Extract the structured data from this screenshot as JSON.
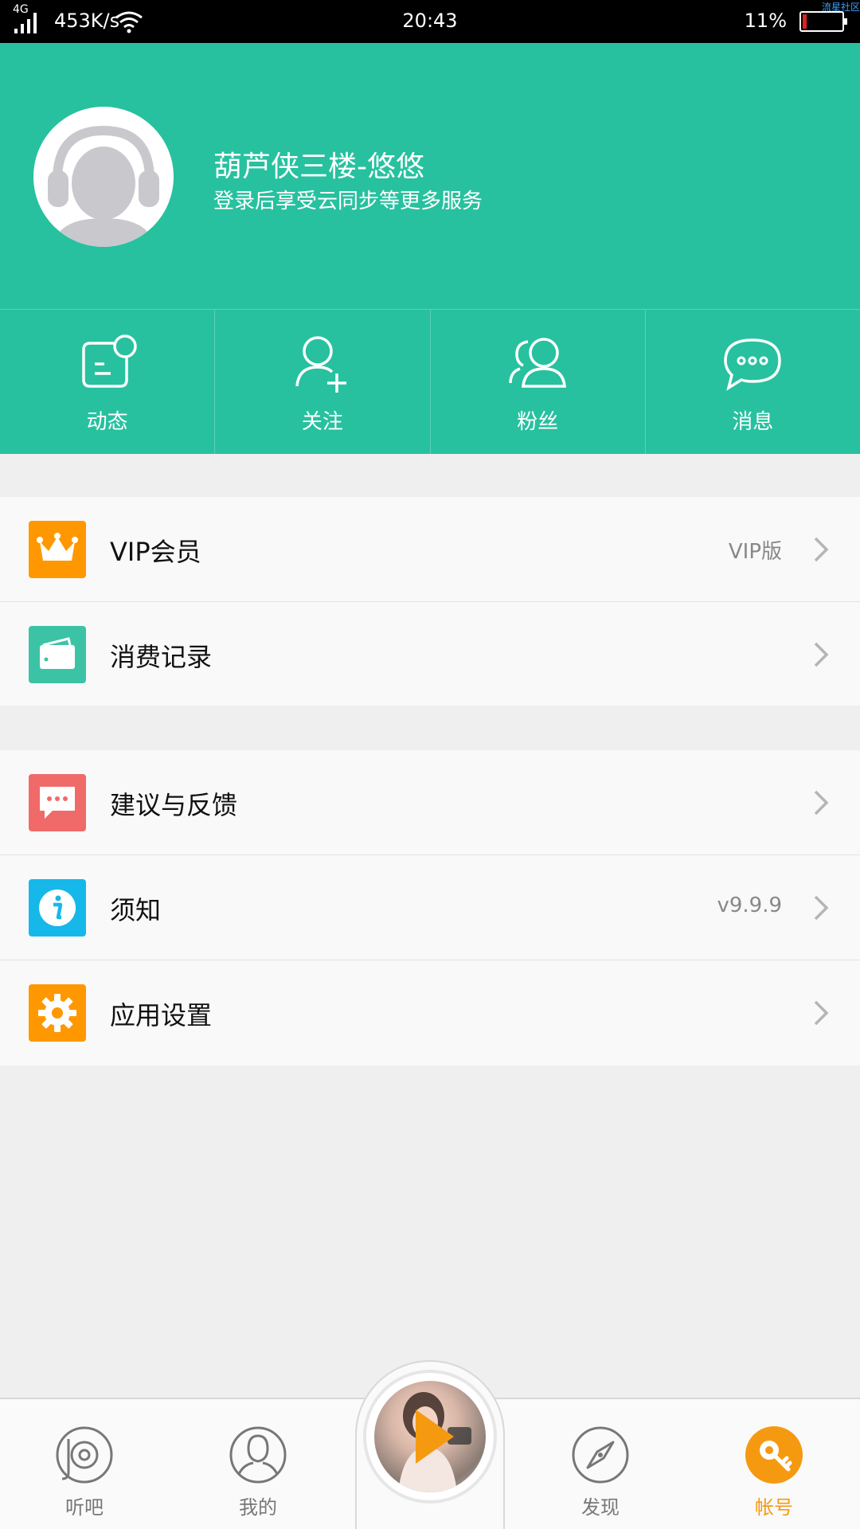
{
  "status_bar": {
    "network": "4G",
    "speed": "453K/s",
    "time": "20:43",
    "battery": "11%",
    "battery_level": 0.11,
    "watermark": "流星社区"
  },
  "profile": {
    "name": "葫芦侠三楼-悠悠",
    "subtitle": "登录后享受云同步等更多服务"
  },
  "stats": [
    {
      "label": "动态",
      "icon": "dynamic-icon"
    },
    {
      "label": "关注",
      "icon": "follow-icon"
    },
    {
      "label": "粉丝",
      "icon": "fans-icon"
    },
    {
      "label": "消息",
      "icon": "message-icon"
    }
  ],
  "menu_group_1": [
    {
      "label": "VIP会员",
      "value": "VIP版",
      "icon": "crown-icon",
      "color": "#ff9800"
    },
    {
      "label": "消费记录",
      "value": "",
      "icon": "wallet-icon",
      "color": "#3cc3a6"
    }
  ],
  "menu_group_2": [
    {
      "label": "建议与反馈",
      "value": "",
      "icon": "feedback-icon",
      "color": "#f06a6a"
    },
    {
      "label": "须知",
      "value": "v9.9.9",
      "icon": "info-icon",
      "color": "#16b8ea"
    },
    {
      "label": "应用设置",
      "value": "",
      "icon": "gear-icon",
      "color": "#ff9800"
    }
  ],
  "bottom_nav": {
    "items": [
      {
        "label": "听吧",
        "icon": "vinyl-icon",
        "active": false
      },
      {
        "label": "我的",
        "icon": "user-icon",
        "active": false
      },
      {
        "label": "发现",
        "icon": "compass-icon",
        "active": false
      },
      {
        "label": "帐号",
        "icon": "key-icon",
        "active": true
      }
    ],
    "play_icon": "play-icon"
  },
  "colors": {
    "header": "#27c19f",
    "accent": "#f59a10"
  }
}
